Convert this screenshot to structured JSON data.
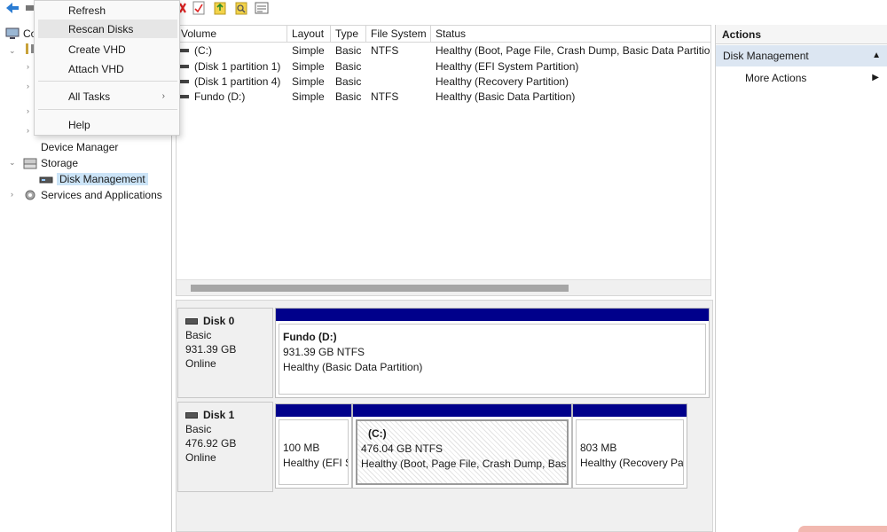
{
  "toolbar": {
    "icons": [
      "back-arrow-icon",
      "console-icon",
      "delete-icon",
      "properties-icon",
      "help-icon",
      "search-icon",
      "view-icon"
    ]
  },
  "context_menu": {
    "items": [
      {
        "label": "Refresh"
      },
      {
        "label": "Rescan Disks"
      },
      {
        "label": "Create VHD"
      },
      {
        "label": "Attach VHD"
      },
      {
        "label": "All Tasks"
      },
      {
        "label": "Help"
      }
    ]
  },
  "tree": {
    "root_label": "Co",
    "device_manager": "Device Manager",
    "storage": "Storage",
    "disk_management": "Disk Management",
    "services": "Services and Applications"
  },
  "volume_list": {
    "columns": [
      "Volume",
      "Layout",
      "Type",
      "File System",
      "Status"
    ],
    "rows": [
      {
        "volume": "(C:)",
        "layout": "Simple",
        "type": "Basic",
        "fs": "NTFS",
        "status": "Healthy (Boot, Page File, Crash Dump, Basic Data Partition)"
      },
      {
        "volume": "(Disk 1 partition 1)",
        "layout": "Simple",
        "type": "Basic",
        "fs": "",
        "status": "Healthy (EFI System Partition)"
      },
      {
        "volume": "(Disk 1 partition 4)",
        "layout": "Simple",
        "type": "Basic",
        "fs": "",
        "status": "Healthy (Recovery Partition)"
      },
      {
        "volume": "Fundo (D:)",
        "layout": "Simple",
        "type": "Basic",
        "fs": "NTFS",
        "status": "Healthy (Basic Data Partition)"
      }
    ]
  },
  "disks": [
    {
      "name": "Disk 0",
      "type": "Basic",
      "size": "931.39 GB",
      "state": "Online",
      "partitions": [
        {
          "title": "Fundo  (D:)",
          "size": "931.39 GB NTFS",
          "status": "Healthy (Basic Data Partition)"
        }
      ]
    },
    {
      "name": "Disk 1",
      "type": "Basic",
      "size": "476.92 GB",
      "state": "Online",
      "partitions": [
        {
          "title": "",
          "size": "100 MB",
          "status": "Healthy (EFI S"
        },
        {
          "title": "(C:)",
          "size": "476.04 GB NTFS",
          "status": "Healthy (Boot, Page File, Crash Dump, Basic"
        },
        {
          "title": "",
          "size": "803 MB",
          "status": "Healthy (Recovery Pa"
        }
      ]
    }
  ],
  "actions": {
    "title": "Actions",
    "section": "Disk Management",
    "item": "More Actions"
  },
  "colors": {
    "partition_bar": "#00008b",
    "selection": "#cce4f7",
    "action_section": "#dce6f2"
  }
}
